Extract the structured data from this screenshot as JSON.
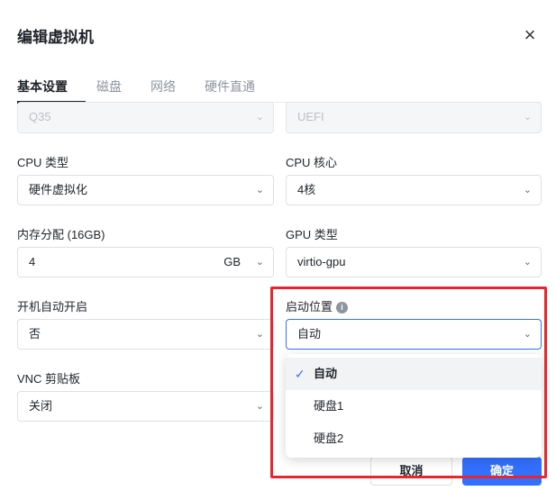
{
  "dialog": {
    "title": "编辑虚拟机",
    "close_icon": "×"
  },
  "tabs": [
    {
      "label": "基本设置",
      "active": true
    },
    {
      "label": "磁盘",
      "active": false
    },
    {
      "label": "网络",
      "active": false
    },
    {
      "label": "硬件直通",
      "active": false
    }
  ],
  "fields": {
    "chipset": {
      "value": "Q35",
      "disabled": true
    },
    "firmware": {
      "value": "UEFI",
      "disabled": true
    },
    "cpu_type": {
      "label": "CPU 类型",
      "value": "硬件虚拟化"
    },
    "cpu_cores": {
      "label": "CPU 核心",
      "value": "4核"
    },
    "memory": {
      "label": "内存分配 (16GB)",
      "value": "4",
      "unit": "GB"
    },
    "gpu_type": {
      "label": "GPU 类型",
      "value": "virtio-gpu"
    },
    "autostart": {
      "label": "开机自动开启",
      "value": "否"
    },
    "boot_location": {
      "label": "启动位置",
      "info_icon": "i",
      "value": "自动"
    },
    "vnc_clipboard": {
      "label": "VNC 剪贴板",
      "value": "关闭"
    }
  },
  "boot_dropdown": {
    "options": [
      "自动",
      "硬盘1",
      "硬盘2"
    ],
    "selected_index": 0,
    "check_icon": "✓"
  },
  "footer": {
    "cancel_label": "取消",
    "ok_label": "确定"
  },
  "colors": {
    "accent": "#3370ff",
    "highlight": "#e8262d"
  },
  "chevron_icon": "⌄"
}
